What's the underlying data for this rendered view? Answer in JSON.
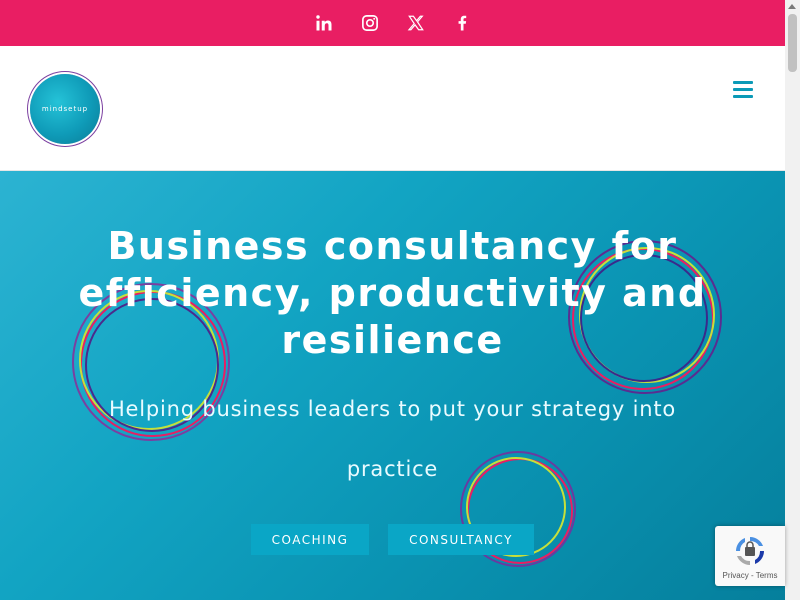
{
  "topbar": {
    "background": "#e91e63",
    "social_icons": [
      "linkedin-icon",
      "instagram-icon",
      "x-twitter-icon",
      "facebook-icon"
    ]
  },
  "header": {
    "logo_text": "mindsetup",
    "menu_icon": "hamburger-menu-icon"
  },
  "hero": {
    "headline": "Business consultancy for efficiency, productivity and resilience",
    "subheadline": "Helping business leaders to put your strategy into practice",
    "buttons": [
      {
        "label": "COACHING"
      },
      {
        "label": "CONSULTANCY"
      }
    ],
    "accent": "#0aa6c6"
  },
  "recaptcha": {
    "privacy_label": "Privacy",
    "separator": " - ",
    "terms_label": "Terms"
  }
}
